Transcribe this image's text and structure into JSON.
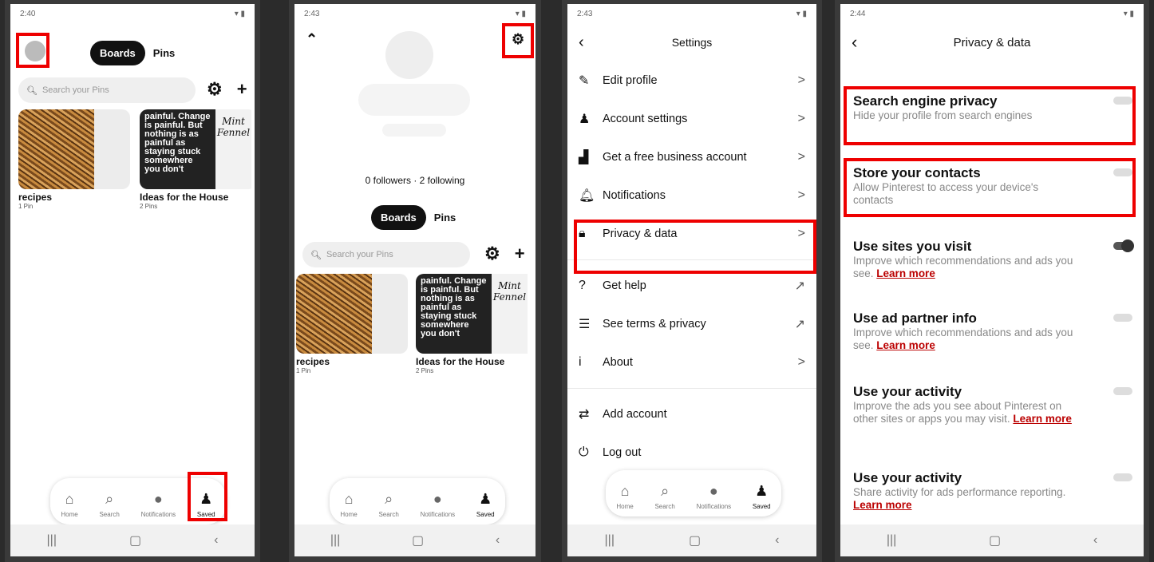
{
  "screen1": {
    "status_time": "2:40",
    "tabs": {
      "boards": "Boards",
      "pins": "Pins"
    },
    "search_placeholder": "Search your Pins",
    "boards": [
      {
        "title": "recipes",
        "sub": "1 Pin"
      },
      {
        "title": "Ideas for the House",
        "sub": "2 Pins"
      }
    ],
    "pin_text": "painful. Change is painful. But nothing is as painful as staying stuck somewhere you don't",
    "mint_text": "Mint Fennel",
    "nav": [
      "Home",
      "Search",
      "Notifications",
      "Saved"
    ]
  },
  "screen2": {
    "status_time": "2:43",
    "followers": "0 followers · 2 following",
    "tabs": {
      "boards": "Boards",
      "pins": "Pins"
    },
    "search_placeholder": "Search your Pins",
    "boards": [
      {
        "title": "recipes",
        "sub": "1 Pin"
      },
      {
        "title": "Ideas for the House",
        "sub": "2 Pins"
      }
    ],
    "pin_text": "painful. Change is painful. But nothing is as painful as staying stuck somewhere you don't",
    "mint_text": "Mint Fennel",
    "nav": [
      "Home",
      "Search",
      "Notifications",
      "Saved"
    ]
  },
  "screen3": {
    "status_time": "2:43",
    "title": "Settings",
    "items": [
      "Edit profile",
      "Account settings",
      "Get a free business account",
      "Notifications",
      "Privacy & data"
    ],
    "items2": [
      "Get help",
      "See terms & privacy",
      "About"
    ],
    "items3": [
      "Add account",
      "Log out"
    ],
    "nav": [
      "Home",
      "Search",
      "Notifications",
      "Saved"
    ]
  },
  "screen4": {
    "status_time": "2:44",
    "title": "Privacy & data",
    "rows": [
      {
        "title": "Search engine privacy",
        "desc": "Hide your profile from search engines",
        "link": "",
        "on": false
      },
      {
        "title": "Store your contacts",
        "desc": "Allow Pinterest to access your device's contacts",
        "link": "",
        "on": false
      },
      {
        "title": "Use sites you visit",
        "desc": "Improve which recommendations and ads you see.",
        "link": "Learn more",
        "on": true
      },
      {
        "title": "Use ad partner info",
        "desc": "Improve which recommendations and ads you see.",
        "link": "Learn more",
        "on": false
      },
      {
        "title": "Use your activity",
        "desc": "Improve the ads you see about Pinterest on other sites or apps you may visit.",
        "link": "Learn more",
        "on": false
      },
      {
        "title": "Use your activity",
        "desc": "Share activity for ads performance reporting.",
        "link": "Learn more",
        "on": false
      }
    ]
  },
  "colors": {
    "highlight": "#e00000",
    "link": "#b00000",
    "dark": "#111111"
  }
}
